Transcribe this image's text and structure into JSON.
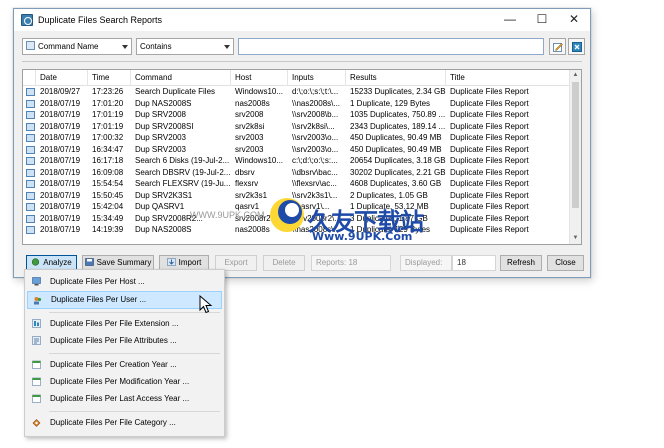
{
  "window": {
    "title": "Duplicate Files Search Reports",
    "controls": {
      "minimize": "—",
      "maximize": "☐",
      "close": "✕"
    }
  },
  "filter": {
    "field_select": "Command Name",
    "operator_select": "Contains",
    "search_value": "",
    "edit_icon": "edit-icon",
    "clear_icon": "clear-filter-icon"
  },
  "table": {
    "columns": [
      "Date",
      "Time",
      "Command",
      "Host",
      "Inputs",
      "Results",
      "Title"
    ],
    "rows": [
      [
        "2018/09/27",
        "17:23:26",
        "Search Duplicate Files",
        "Windows10...",
        "d:\\;o:\\;s:\\;t:\\...",
        "15233 Duplicates, 2.34 GB",
        "Duplicate Files Report"
      ],
      [
        "2018/07/19",
        "17:01:20",
        "Dup NAS2008S",
        "nas2008s",
        "\\\\nas2008s\\...",
        "1 Duplicate, 129 Bytes",
        "Duplicate Files Report"
      ],
      [
        "2018/07/19",
        "17:01:19",
        "Dup SRV2008",
        "srv2008",
        "\\\\srv2008\\b...",
        "1035 Duplicates, 750.89 ...",
        "Duplicate Files Report"
      ],
      [
        "2018/07/19",
        "17:01:19",
        "Dup SRV2008SI",
        "srv2k8si",
        "\\\\srv2k8si\\...",
        "2343 Duplicates, 189.14 ...",
        "Duplicate Files Report"
      ],
      [
        "2018/07/19",
        "17:00:32",
        "Dup SRV2003",
        "srv2003",
        "\\\\srv2003\\o...",
        "450 Duplicates, 90.49 MB",
        "Duplicate Files Report"
      ],
      [
        "2018/07/19",
        "16:34:47",
        "Dup SRV2003",
        "srv2003",
        "\\\\srv2003\\o...",
        "450 Duplicates, 90.49 MB",
        "Duplicate Files Report"
      ],
      [
        "2018/07/19",
        "16:17:18",
        "Search 6 Disks (19-Jul-2...",
        "Windows10...",
        "c:\\;d:\\;o:\\;s:...",
        "20654 Duplicates, 3.18 GB",
        "Duplicate Files Report"
      ],
      [
        "2018/07/19",
        "16:09:08",
        "Search DBSRV (19-Jul-2...",
        "dbsrv",
        "\\\\dbsrv\\bac...",
        "30202 Duplicates, 2.21 GB",
        "Duplicate Files Report"
      ],
      [
        "2018/07/19",
        "15:54:54",
        "Search FLEXSRV (19-Ju...",
        "flexsrv",
        "\\\\flexsrv\\ac...",
        "4608 Duplicates, 3.60 GB",
        "Duplicate Files Report"
      ],
      [
        "2018/07/19",
        "15:50:45",
        "Dup SRV2K3S1",
        "srv2k3s1",
        "\\\\srv2k3s1\\...",
        "2 Duplicates, 1.05 GB",
        "Duplicate Files Report"
      ],
      [
        "2018/07/19",
        "15:42:04",
        "Dup QASRV1",
        "qasrv1",
        "\\\\qasrv1\\...",
        "1 Duplicate, 53.12 MB",
        "Duplicate Files Report"
      ],
      [
        "2018/07/19",
        "15:34:49",
        "Dup SRV2008R2...",
        "srv2008r2",
        "\\\\srv2008r2\\...",
        "3 Duplicates, 1.87 GB",
        "Duplicate Files Report"
      ],
      [
        "2018/07/19",
        "14:19:39",
        "Dup NAS2008S",
        "nas2008s",
        "\\\\nas2008s\\...",
        "1 Duplicate, 129 Bytes",
        "Duplicate Files Report"
      ]
    ]
  },
  "toolbar": {
    "analyze": "Analyze",
    "save_summary": "Save Summary",
    "import": "Import",
    "export": "Export",
    "delete": "Delete",
    "reports_label": "Reports: 18",
    "displayed_label": "Displayed:",
    "displayed_value": "18",
    "refresh": "Refresh",
    "close": "Close"
  },
  "menu": {
    "items": [
      "Duplicate Files Per Host ...",
      "Duplicate Files Per User ...",
      "Duplicate Files Per File Extension ...",
      "Duplicate Files Per File Attributes ...",
      "Duplicate Files Per Creation Year ...",
      "Duplicate Files Per Modification Year ...",
      "Duplicate Files Per Last Access Year ...",
      "Duplicate Files Per File Category ..."
    ]
  },
  "watermark": {
    "left_text": "WWW.9UPK.COM",
    "brand": "久友下载站",
    "url": "Www.9UPK.Com"
  },
  "colors": {
    "accent": "#0078d7",
    "menu_hover": "#cde8ff",
    "watermark_blue": "#1e4aa8"
  }
}
